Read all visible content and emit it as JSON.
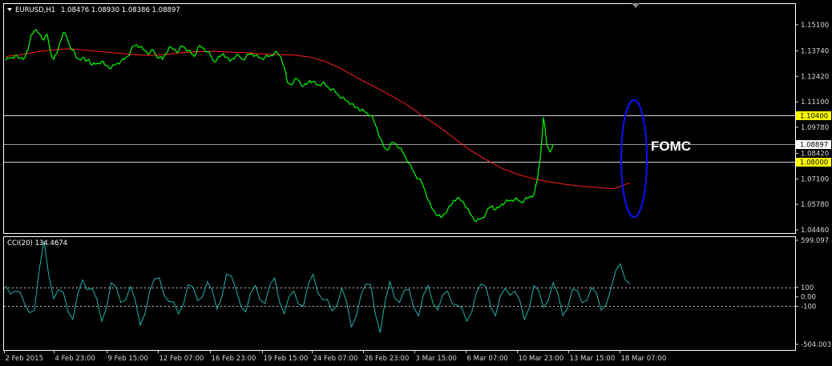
{
  "header": {
    "triangle_icon": "triangle-down-icon",
    "symbol_timeframe": "EURUSD,H1",
    "ohlc": "1.08476 1.08930 1.08386 1.08897"
  },
  "indicator": {
    "label": "CCI(20) 134.4674"
  },
  "annotation": {
    "text": "FOMC"
  },
  "colors": {
    "background": "#000000",
    "price_line": "#00ff00",
    "moving_average": "#ff2020",
    "cci_line": "#20b2aa",
    "highlight": "#ffff00",
    "ellipse": "#1010ff",
    "frame": "#ffffff"
  },
  "chart_data": [
    {
      "type": "line",
      "title": "EURUSD,H1",
      "ylim": [
        1.0446,
        1.159
      ],
      "y_ticks": [
        "1.15100",
        "1.13740",
        "1.12420",
        "1.11100",
        "1.09780",
        "1.08420",
        "1.07100",
        "1.05780",
        "1.04460"
      ],
      "x_ticks": [
        "2 Feb 2015",
        "4 Feb 23:00",
        "9 Feb 15:00",
        "12 Feb 07:00",
        "16 Feb 23:00",
        "19 Feb 15:00",
        "24 Feb 07:00",
        "26 Feb 23:00",
        "3 Mar 15:00",
        "6 Mar 07:00",
        "10 Mar 23:00",
        "13 Mar 15:00",
        "18 Mar 07:00"
      ],
      "horizontal_lines": [
        {
          "value": 1.104,
          "label": "1.10400",
          "highlight": true
        },
        {
          "value": 1.08897,
          "label": "1.08897",
          "highlight": false
        },
        {
          "value": 1.08,
          "label": "1.08000",
          "highlight": true
        }
      ],
      "series": [
        {
          "x_index": [
            0,
            2,
            4,
            6,
            8,
            10,
            12,
            14,
            16,
            18,
            20,
            22,
            24,
            26,
            28,
            30,
            32,
            34,
            36,
            38,
            40,
            42,
            44,
            46,
            48,
            50,
            52,
            54,
            56,
            58,
            60,
            62,
            64,
            66,
            68,
            70,
            72,
            74,
            76,
            78,
            80,
            82,
            84,
            86,
            88,
            90,
            92,
            94,
            96,
            98,
            100,
            102,
            104,
            106,
            108,
            110,
            112,
            114,
            116,
            118,
            120,
            122,
            124,
            126,
            128,
            130,
            132,
            134,
            136,
            138,
            140,
            142,
            144,
            146,
            148,
            150,
            152,
            154,
            156,
            158,
            160,
            162,
            164,
            166,
            168,
            170,
            172,
            174,
            176,
            178,
            180,
            182,
            184,
            186,
            188,
            190,
            192,
            194,
            196,
            198,
            200,
            202,
            204,
            206,
            208,
            210,
            212,
            214,
            216,
            218,
            220,
            222,
            224,
            226,
            228,
            230,
            232,
            234,
            236,
            238,
            240,
            242,
            244,
            246,
            248,
            250,
            252,
            254,
            256,
            258,
            260,
            262,
            264,
            266,
            268,
            270,
            272,
            274,
            276,
            278,
            280,
            282,
            284,
            286,
            288,
            290,
            292,
            294,
            296,
            298,
            300,
            302,
            304,
            306,
            308,
            310,
            312,
            314,
            316,
            318,
            320,
            322,
            324,
            326,
            328,
            330,
            332,
            334,
            336,
            338,
            340,
            342,
            344,
            346,
            348,
            350,
            352,
            354,
            356,
            358,
            360,
            362,
            364,
            366,
            368,
            370,
            372,
            374,
            376,
            378,
            380,
            382,
            384,
            386,
            388,
            390
          ],
          "values": [
            1.1325,
            1.1335,
            1.134,
            1.135,
            1.1335,
            1.134,
            1.1338,
            1.138,
            1.146,
            1.148,
            1.147,
            1.1455,
            1.143,
            1.146,
            1.137,
            1.133,
            1.136,
            1.142,
            1.147,
            1.145,
            1.14,
            1.138,
            1.134,
            1.133,
            1.134,
            1.132,
            1.133,
            1.13,
            1.1305,
            1.131,
            1.132,
            1.13,
            1.1295,
            1.1285,
            1.13,
            1.131,
            1.132,
            1.133,
            1.1345,
            1.137,
            1.14,
            1.1405,
            1.1395,
            1.138,
            1.137,
            1.136,
            1.138,
            1.135,
            1.134,
            1.133,
            1.136,
            1.139,
            1.1385,
            1.138,
            1.137,
            1.14,
            1.139,
            1.1375,
            1.136,
            1.1345,
            1.139,
            1.1395,
            1.1385,
            1.137,
            1.135,
            1.132,
            1.133,
            1.1345,
            1.136,
            1.134,
            1.132,
            1.1335,
            1.135,
            1.1345,
            1.133,
            1.134,
            1.1355,
            1.136,
            1.135,
            1.134,
            1.1335,
            1.134,
            1.1345,
            1.135,
            1.1365,
            1.136,
            1.134,
            1.129,
            1.121,
            1.12,
            1.1215,
            1.123,
            1.121,
            1.119,
            1.12,
            1.122,
            1.1215,
            1.12,
            1.1195,
            1.121,
            1.1195,
            1.118,
            1.1175,
            1.116,
            1.1145,
            1.113,
            1.112,
            1.111,
            1.11,
            1.108,
            1.108,
            1.1065,
            1.106,
            1.105,
            1.104,
            1.101,
            1.097,
            1.092,
            1.088,
            1.086,
            1.088,
            1.09,
            1.089,
            1.087,
            1.085,
            1.082,
            1.079,
            1.076,
            1.073,
            1.071,
            1.069,
            1.065,
            1.06,
            1.056,
            1.054,
            1.052,
            1.051,
            1.053,
            1.055,
            1.057,
            1.06,
            1.061,
            1.06,
            1.059,
            1.056,
            1.053,
            1.051,
            1.049,
            1.05,
            1.051,
            1.053,
            1.056,
            1.057,
            1.055,
            1.056,
            1.058,
            1.059,
            1.0595,
            1.06,
            1.0605,
            1.06,
            1.059,
            1.06,
            1.061,
            1.062,
            1.063,
            1.07,
            1.082,
            1.103,
            1.089,
            1.085,
            1.089
          ],
          "name": ""
        },
        {
          "x_index": [
            0,
            10,
            20,
            30,
            40,
            50,
            60,
            70,
            80,
            90,
            100,
            110,
            120,
            130,
            140,
            150,
            160,
            170,
            180,
            190,
            200,
            210,
            220,
            230,
            240,
            250,
            260,
            270,
            280,
            290,
            300,
            310,
            320,
            330,
            340,
            350,
            360,
            370,
            380,
            390
          ],
          "values": [
            1.1345,
            1.1355,
            1.137,
            1.138,
            1.1385,
            1.1378,
            1.137,
            1.1362,
            1.1355,
            1.135,
            1.1355,
            1.1365,
            1.137,
            1.1372,
            1.1368,
            1.1365,
            1.1358,
            1.1355,
            1.1352,
            1.1342,
            1.1318,
            1.128,
            1.1232,
            1.119,
            1.1145,
            1.1098,
            1.104,
            1.0985,
            1.0922,
            1.086,
            1.081,
            1.0765,
            1.0733,
            1.071,
            1.0694,
            1.0682,
            1.0672,
            1.0665,
            1.066,
            1.069
          ],
          "name": ""
        }
      ]
    },
    {
      "type": "line",
      "title": "CCI(20) 134.4674",
      "ylim": [
        -504.003,
        599.097
      ],
      "y_ticks": [
        "599.097",
        "100",
        "0.00",
        "-100",
        "-504.003"
      ],
      "levels": [
        100,
        -100
      ],
      "series": [
        {
          "name": "",
          "x_index": [
            0,
            6,
            12,
            18,
            24,
            30,
            36,
            42,
            48,
            54,
            60,
            66,
            72,
            78,
            84,
            90,
            96,
            102,
            108,
            114,
            120,
            126,
            132,
            138,
            144,
            150,
            156,
            162,
            168,
            174,
            180,
            186,
            192,
            198,
            204,
            210,
            216,
            222,
            228,
            234,
            240,
            246,
            252,
            258,
            264,
            270,
            276,
            282,
            288,
            294,
            300,
            306,
            312,
            318,
            324,
            330,
            336,
            342,
            348,
            354,
            360,
            366,
            372,
            378,
            384,
            390
          ],
          "values": [
            120,
            60,
            -80,
            -140,
            590,
            -20,
            50,
            -240,
            180,
            90,
            -260,
            150,
            -60,
            110,
            -300,
            60,
            200,
            -50,
            -180,
            130,
            -40,
            160,
            -130,
            240,
            80,
            -160,
            120,
            -70,
            200,
            -180,
            60,
            -100,
            240,
            -30,
            -150,
            90,
            -320,
            20,
            130,
            -380,
            160,
            -60,
            80,
            -200,
            120,
            -140,
            60,
            -90,
            -260,
            40,
            110,
            -200,
            90,
            60,
            -240,
            120,
            -110,
            150,
            -200,
            80,
            -60,
            100,
            -140,
            80,
            350,
            134
          ]
        }
      ]
    }
  ]
}
